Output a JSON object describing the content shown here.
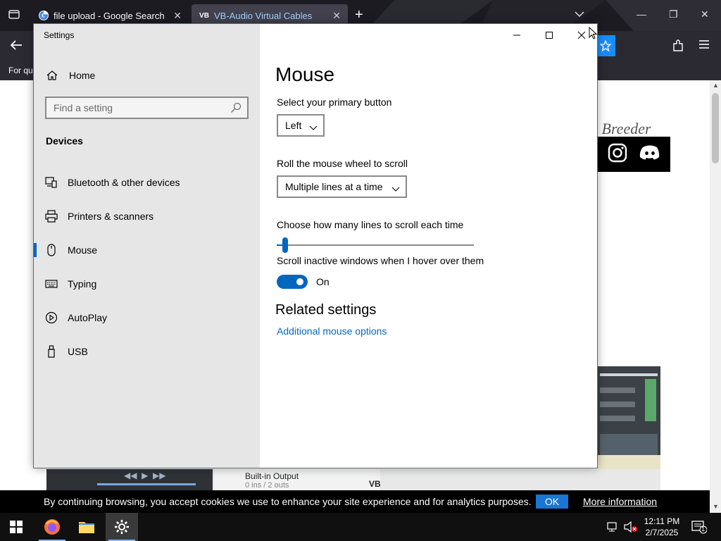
{
  "browser": {
    "tabs": [
      {
        "title": "file upload - Google Search",
        "favicon": "google-icon",
        "active": false
      },
      {
        "title": "VB-Audio Virtual Cables",
        "favicon": "vb-icon",
        "active": true
      }
    ],
    "infobar_text": "For qu"
  },
  "web": {
    "breeder_text": "d Breeder",
    "mixer_output_title": "Built-in Output",
    "mixer_output_sub": "0 ins / 2 outs",
    "vb_label": "VB"
  },
  "settings": {
    "window_title": "Settings",
    "nav": {
      "home_label": "Home",
      "search_placeholder": "Find a setting",
      "group_title": "Devices",
      "items": [
        {
          "label": "Bluetooth & other devices",
          "icon": "bluetooth-devices-icon"
        },
        {
          "label": "Printers & scanners",
          "icon": "printer-icon"
        },
        {
          "label": "Mouse",
          "icon": "mouse-icon",
          "active": true
        },
        {
          "label": "Typing",
          "icon": "keyboard-icon"
        },
        {
          "label": "AutoPlay",
          "icon": "autoplay-icon"
        },
        {
          "label": "USB",
          "icon": "usb-icon"
        }
      ]
    },
    "content": {
      "title": "Mouse",
      "primary_button_label": "Select your primary button",
      "primary_button_value": "Left",
      "wheel_label": "Roll the mouse wheel to scroll",
      "wheel_value": "Multiple lines at a time",
      "lines_label": "Choose how many lines to scroll each time",
      "lines_slider_fraction": 0.03,
      "inactive_label": "Scroll inactive windows when I hover over them",
      "inactive_state": "On",
      "related_title": "Related settings",
      "related_link": "Additional mouse options"
    }
  },
  "cookie": {
    "text": "By continuing browsing, you accept cookies we use to enhance your site experience and for analytics purposes.",
    "ok_label": "OK",
    "more_label": "More information"
  },
  "taskbar": {
    "time": "12:11 PM",
    "date": "2/7/2025",
    "notification_count": "1"
  },
  "colors": {
    "accent": "#0067c0",
    "nav_bg": "#e6e6e6",
    "tabbar_bg": "#1c1b22",
    "cookie_ok": "#1976d2"
  }
}
